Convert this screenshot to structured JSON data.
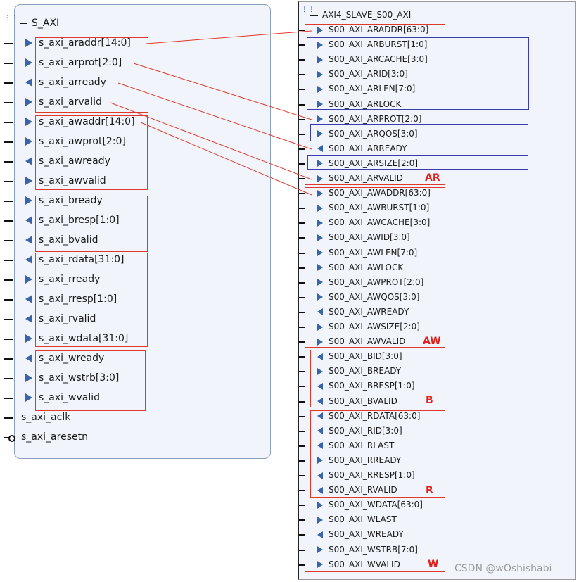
{
  "left_block": {
    "title": "S_AXI",
    "pins": [
      {
        "label": "s_axi_araddr[14:0]",
        "dir": "in"
      },
      {
        "label": "s_axi_arprot[2:0]",
        "dir": "in"
      },
      {
        "label": "s_axi_arready",
        "dir": "out"
      },
      {
        "label": "s_axi_arvalid",
        "dir": "in"
      },
      {
        "label": "s_axi_awaddr[14:0]",
        "dir": "in"
      },
      {
        "label": "s_axi_awprot[2:0]",
        "dir": "in"
      },
      {
        "label": "s_axi_awready",
        "dir": "out"
      },
      {
        "label": "s_axi_awvalid",
        "dir": "in"
      },
      {
        "label": "s_axi_bready",
        "dir": "in"
      },
      {
        "label": "s_axi_bresp[1:0]",
        "dir": "out"
      },
      {
        "label": "s_axi_bvalid",
        "dir": "out"
      },
      {
        "label": "s_axi_rdata[31:0]",
        "dir": "out"
      },
      {
        "label": "s_axi_rready",
        "dir": "in"
      },
      {
        "label": "s_axi_rresp[1:0]",
        "dir": "out"
      },
      {
        "label": "s_axi_rvalid",
        "dir": "out"
      },
      {
        "label": "s_axi_wdata[31:0]",
        "dir": "in"
      },
      {
        "label": "s_axi_wready",
        "dir": "out"
      },
      {
        "label": "s_axi_wstrb[3:0]",
        "dir": "in"
      },
      {
        "label": "s_axi_wvalid",
        "dir": "in"
      }
    ],
    "clock": "s_axi_aclk",
    "reset": "s_axi_aresetn"
  },
  "right_block": {
    "title": "AXI4_SLAVE_S00_AXI",
    "pins": [
      {
        "label": "S00_AXI_ARADDR[63:0]",
        "dir": "in"
      },
      {
        "label": "S00_AXI_ARBURST[1:0]",
        "dir": "in"
      },
      {
        "label": "S00_AXI_ARCACHE[3:0]",
        "dir": "in"
      },
      {
        "label": "S00_AXI_ARID[3:0]",
        "dir": "in"
      },
      {
        "label": "S00_AXI_ARLEN[7:0]",
        "dir": "in"
      },
      {
        "label": "S00_AXI_ARLOCK",
        "dir": "in"
      },
      {
        "label": "S00_AXI_ARPROT[2:0]",
        "dir": "in"
      },
      {
        "label": "S00_AXI_ARQOS[3:0]",
        "dir": "in"
      },
      {
        "label": "S00_AXI_ARREADY",
        "dir": "out"
      },
      {
        "label": "S00_AXI_ARSIZE[2:0]",
        "dir": "in"
      },
      {
        "label": "S00_AXI_ARVALID",
        "dir": "in"
      },
      {
        "label": "S00_AXI_AWADDR[63:0]",
        "dir": "in"
      },
      {
        "label": "S00_AXI_AWBURST[1:0]",
        "dir": "in"
      },
      {
        "label": "S00_AXI_AWCACHE[3:0]",
        "dir": "in"
      },
      {
        "label": "S00_AXI_AWID[3:0]",
        "dir": "in"
      },
      {
        "label": "S00_AXI_AWLEN[7:0]",
        "dir": "in"
      },
      {
        "label": "S00_AXI_AWLOCK",
        "dir": "in"
      },
      {
        "label": "S00_AXI_AWPROT[2:0]",
        "dir": "in"
      },
      {
        "label": "S00_AXI_AWQOS[3:0]",
        "dir": "in"
      },
      {
        "label": "S00_AXI_AWREADY",
        "dir": "out"
      },
      {
        "label": "S00_AXI_AWSIZE[2:0]",
        "dir": "in"
      },
      {
        "label": "S00_AXI_AWVALID",
        "dir": "in"
      },
      {
        "label": "S00_AXI_BID[3:0]",
        "dir": "out"
      },
      {
        "label": "S00_AXI_BREADY",
        "dir": "in"
      },
      {
        "label": "S00_AXI_BRESP[1:0]",
        "dir": "out"
      },
      {
        "label": "S00_AXI_BVALID",
        "dir": "out"
      },
      {
        "label": "S00_AXI_RDATA[63:0]",
        "dir": "out"
      },
      {
        "label": "S00_AXI_RID[3:0]",
        "dir": "out"
      },
      {
        "label": "S00_AXI_RLAST",
        "dir": "out"
      },
      {
        "label": "S00_AXI_RREADY",
        "dir": "in"
      },
      {
        "label": "S00_AXI_RRESP[1:0]",
        "dir": "out"
      },
      {
        "label": "S00_AXI_RVALID",
        "dir": "out"
      },
      {
        "label": "S00_AXI_WDATA[63:0]",
        "dir": "in"
      },
      {
        "label": "S00_AXI_WLAST",
        "dir": "in"
      },
      {
        "label": "S00_AXI_WREADY",
        "dir": "out"
      },
      {
        "label": "S00_AXI_WSTRB[7:0]",
        "dir": "in"
      },
      {
        "label": "S00_AXI_WVALID",
        "dir": "in"
      }
    ]
  },
  "group_labels": {
    "ar": "AR",
    "aw": "AW",
    "b": "B",
    "r": "R",
    "w": "W"
  },
  "watermark": "CSDN @wOshishabi",
  "colors": {
    "annotation": "#e0392b",
    "highlight": "#3b3bb0",
    "port_arrow": "#3a64a8"
  }
}
